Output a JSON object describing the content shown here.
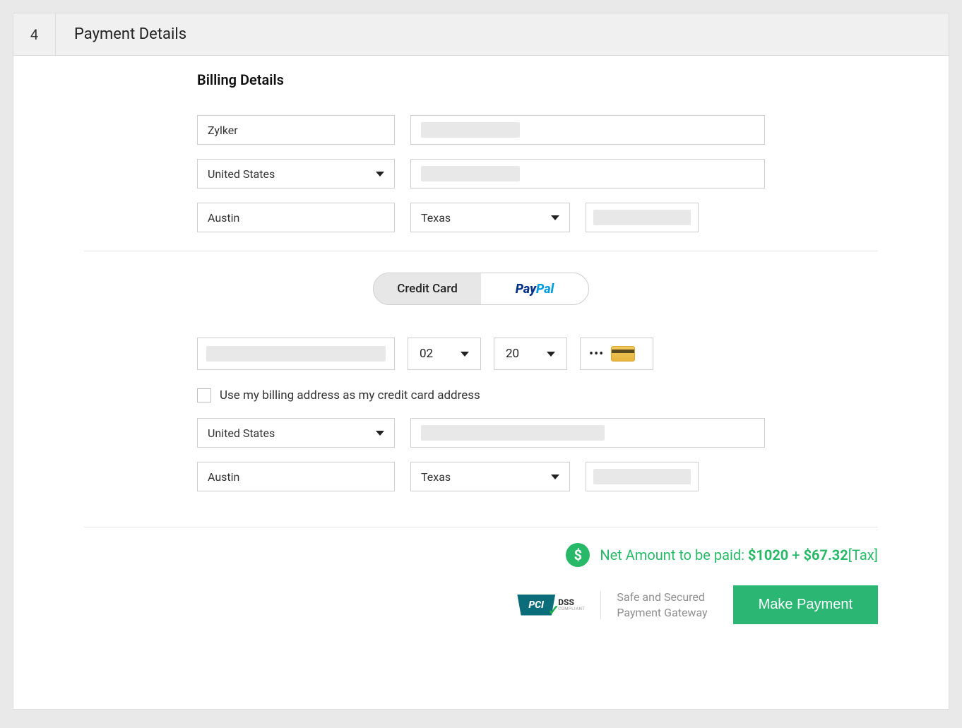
{
  "header": {
    "step_number": "4",
    "title": "Payment Details"
  },
  "billing": {
    "section_title": "Billing Details",
    "name": "Zylker",
    "country": "United States",
    "city": "Austin",
    "state": "Texas"
  },
  "payment_method": {
    "credit_card_label": "Credit Card",
    "paypal_pay": "Pay",
    "paypal_pal": "Pal"
  },
  "card": {
    "exp_month": "02",
    "exp_year": "20",
    "cvv_mask": "•••",
    "use_billing_label": "Use my billing address as my credit card address",
    "country": "United States",
    "city": "Austin",
    "state": "Texas"
  },
  "footer": {
    "dollar": "$",
    "net_label": "Net Amount to be paid: ",
    "net_amount": "$1020",
    "plus": " + ",
    "tax_amount": "$67.32",
    "tax_suffix": "[Tax]",
    "pci_text": "PCI",
    "dss_text": "DSS",
    "dss_sub": "COMPLIANT",
    "secure_line1": "Safe and Secured",
    "secure_line2": "Payment Gateway",
    "button": "Make Payment"
  }
}
